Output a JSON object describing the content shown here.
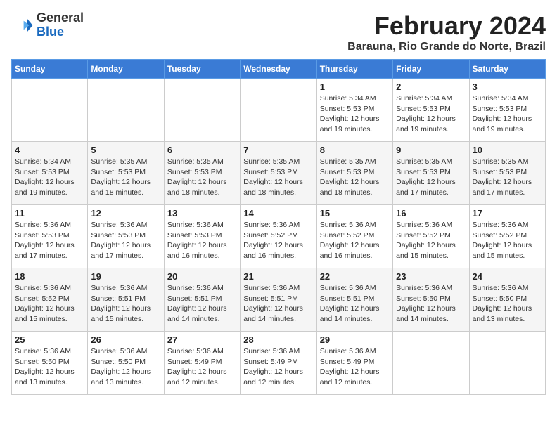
{
  "header": {
    "logo_general": "General",
    "logo_blue": "Blue",
    "month_year": "February 2024",
    "location": "Barauna, Rio Grande do Norte, Brazil"
  },
  "weekdays": [
    "Sunday",
    "Monday",
    "Tuesday",
    "Wednesday",
    "Thursday",
    "Friday",
    "Saturday"
  ],
  "weeks": [
    [
      {
        "day": "",
        "info": ""
      },
      {
        "day": "",
        "info": ""
      },
      {
        "day": "",
        "info": ""
      },
      {
        "day": "",
        "info": ""
      },
      {
        "day": "1",
        "info": "Sunrise: 5:34 AM\nSunset: 5:53 PM\nDaylight: 12 hours\nand 19 minutes."
      },
      {
        "day": "2",
        "info": "Sunrise: 5:34 AM\nSunset: 5:53 PM\nDaylight: 12 hours\nand 19 minutes."
      },
      {
        "day": "3",
        "info": "Sunrise: 5:34 AM\nSunset: 5:53 PM\nDaylight: 12 hours\nand 19 minutes."
      }
    ],
    [
      {
        "day": "4",
        "info": "Sunrise: 5:34 AM\nSunset: 5:53 PM\nDaylight: 12 hours\nand 19 minutes."
      },
      {
        "day": "5",
        "info": "Sunrise: 5:35 AM\nSunset: 5:53 PM\nDaylight: 12 hours\nand 18 minutes."
      },
      {
        "day": "6",
        "info": "Sunrise: 5:35 AM\nSunset: 5:53 PM\nDaylight: 12 hours\nand 18 minutes."
      },
      {
        "day": "7",
        "info": "Sunrise: 5:35 AM\nSunset: 5:53 PM\nDaylight: 12 hours\nand 18 minutes."
      },
      {
        "day": "8",
        "info": "Sunrise: 5:35 AM\nSunset: 5:53 PM\nDaylight: 12 hours\nand 18 minutes."
      },
      {
        "day": "9",
        "info": "Sunrise: 5:35 AM\nSunset: 5:53 PM\nDaylight: 12 hours\nand 17 minutes."
      },
      {
        "day": "10",
        "info": "Sunrise: 5:35 AM\nSunset: 5:53 PM\nDaylight: 12 hours\nand 17 minutes."
      }
    ],
    [
      {
        "day": "11",
        "info": "Sunrise: 5:36 AM\nSunset: 5:53 PM\nDaylight: 12 hours\nand 17 minutes."
      },
      {
        "day": "12",
        "info": "Sunrise: 5:36 AM\nSunset: 5:53 PM\nDaylight: 12 hours\nand 17 minutes."
      },
      {
        "day": "13",
        "info": "Sunrise: 5:36 AM\nSunset: 5:53 PM\nDaylight: 12 hours\nand 16 minutes."
      },
      {
        "day": "14",
        "info": "Sunrise: 5:36 AM\nSunset: 5:52 PM\nDaylight: 12 hours\nand 16 minutes."
      },
      {
        "day": "15",
        "info": "Sunrise: 5:36 AM\nSunset: 5:52 PM\nDaylight: 12 hours\nand 16 minutes."
      },
      {
        "day": "16",
        "info": "Sunrise: 5:36 AM\nSunset: 5:52 PM\nDaylight: 12 hours\nand 15 minutes."
      },
      {
        "day": "17",
        "info": "Sunrise: 5:36 AM\nSunset: 5:52 PM\nDaylight: 12 hours\nand 15 minutes."
      }
    ],
    [
      {
        "day": "18",
        "info": "Sunrise: 5:36 AM\nSunset: 5:52 PM\nDaylight: 12 hours\nand 15 minutes."
      },
      {
        "day": "19",
        "info": "Sunrise: 5:36 AM\nSunset: 5:51 PM\nDaylight: 12 hours\nand 15 minutes."
      },
      {
        "day": "20",
        "info": "Sunrise: 5:36 AM\nSunset: 5:51 PM\nDaylight: 12 hours\nand 14 minutes."
      },
      {
        "day": "21",
        "info": "Sunrise: 5:36 AM\nSunset: 5:51 PM\nDaylight: 12 hours\nand 14 minutes."
      },
      {
        "day": "22",
        "info": "Sunrise: 5:36 AM\nSunset: 5:51 PM\nDaylight: 12 hours\nand 14 minutes."
      },
      {
        "day": "23",
        "info": "Sunrise: 5:36 AM\nSunset: 5:50 PM\nDaylight: 12 hours\nand 14 minutes."
      },
      {
        "day": "24",
        "info": "Sunrise: 5:36 AM\nSunset: 5:50 PM\nDaylight: 12 hours\nand 13 minutes."
      }
    ],
    [
      {
        "day": "25",
        "info": "Sunrise: 5:36 AM\nSunset: 5:50 PM\nDaylight: 12 hours\nand 13 minutes."
      },
      {
        "day": "26",
        "info": "Sunrise: 5:36 AM\nSunset: 5:50 PM\nDaylight: 12 hours\nand 13 minutes."
      },
      {
        "day": "27",
        "info": "Sunrise: 5:36 AM\nSunset: 5:49 PM\nDaylight: 12 hours\nand 12 minutes."
      },
      {
        "day": "28",
        "info": "Sunrise: 5:36 AM\nSunset: 5:49 PM\nDaylight: 12 hours\nand 12 minutes."
      },
      {
        "day": "29",
        "info": "Sunrise: 5:36 AM\nSunset: 5:49 PM\nDaylight: 12 hours\nand 12 minutes."
      },
      {
        "day": "",
        "info": ""
      },
      {
        "day": "",
        "info": ""
      }
    ]
  ]
}
